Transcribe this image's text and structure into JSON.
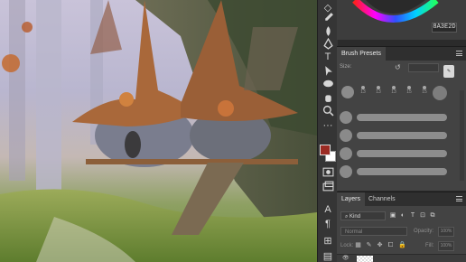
{
  "color_panel": {
    "hex_value": "8A3E2D",
    "hue_ring": "color-wheel"
  },
  "brush_presets": {
    "tab_label": "Brush Presets",
    "size_label": "Size:",
    "presets": [
      {
        "number": "13"
      },
      {
        "number": "13"
      },
      {
        "number": "13"
      },
      {
        "number": "15"
      },
      {
        "number": "15"
      },
      {
        "number": "15"
      },
      {
        "number": "15"
      }
    ],
    "stroke_count": 4
  },
  "layers": {
    "tabs": [
      {
        "label": "Layers"
      },
      {
        "label": "Channels"
      }
    ],
    "kind_label": "Kind",
    "blend_mode": "Normal",
    "opacity_label": "Opacity:",
    "opacity_value": "100%",
    "lock_label": "Lock:",
    "fill_label": "Fill:",
    "fill_value": "100%"
  },
  "colors": {
    "foreground": "#9b2b23",
    "background": "#ffffff",
    "panel_bg": "#434343",
    "tab_bar": "#2f2f2f"
  }
}
